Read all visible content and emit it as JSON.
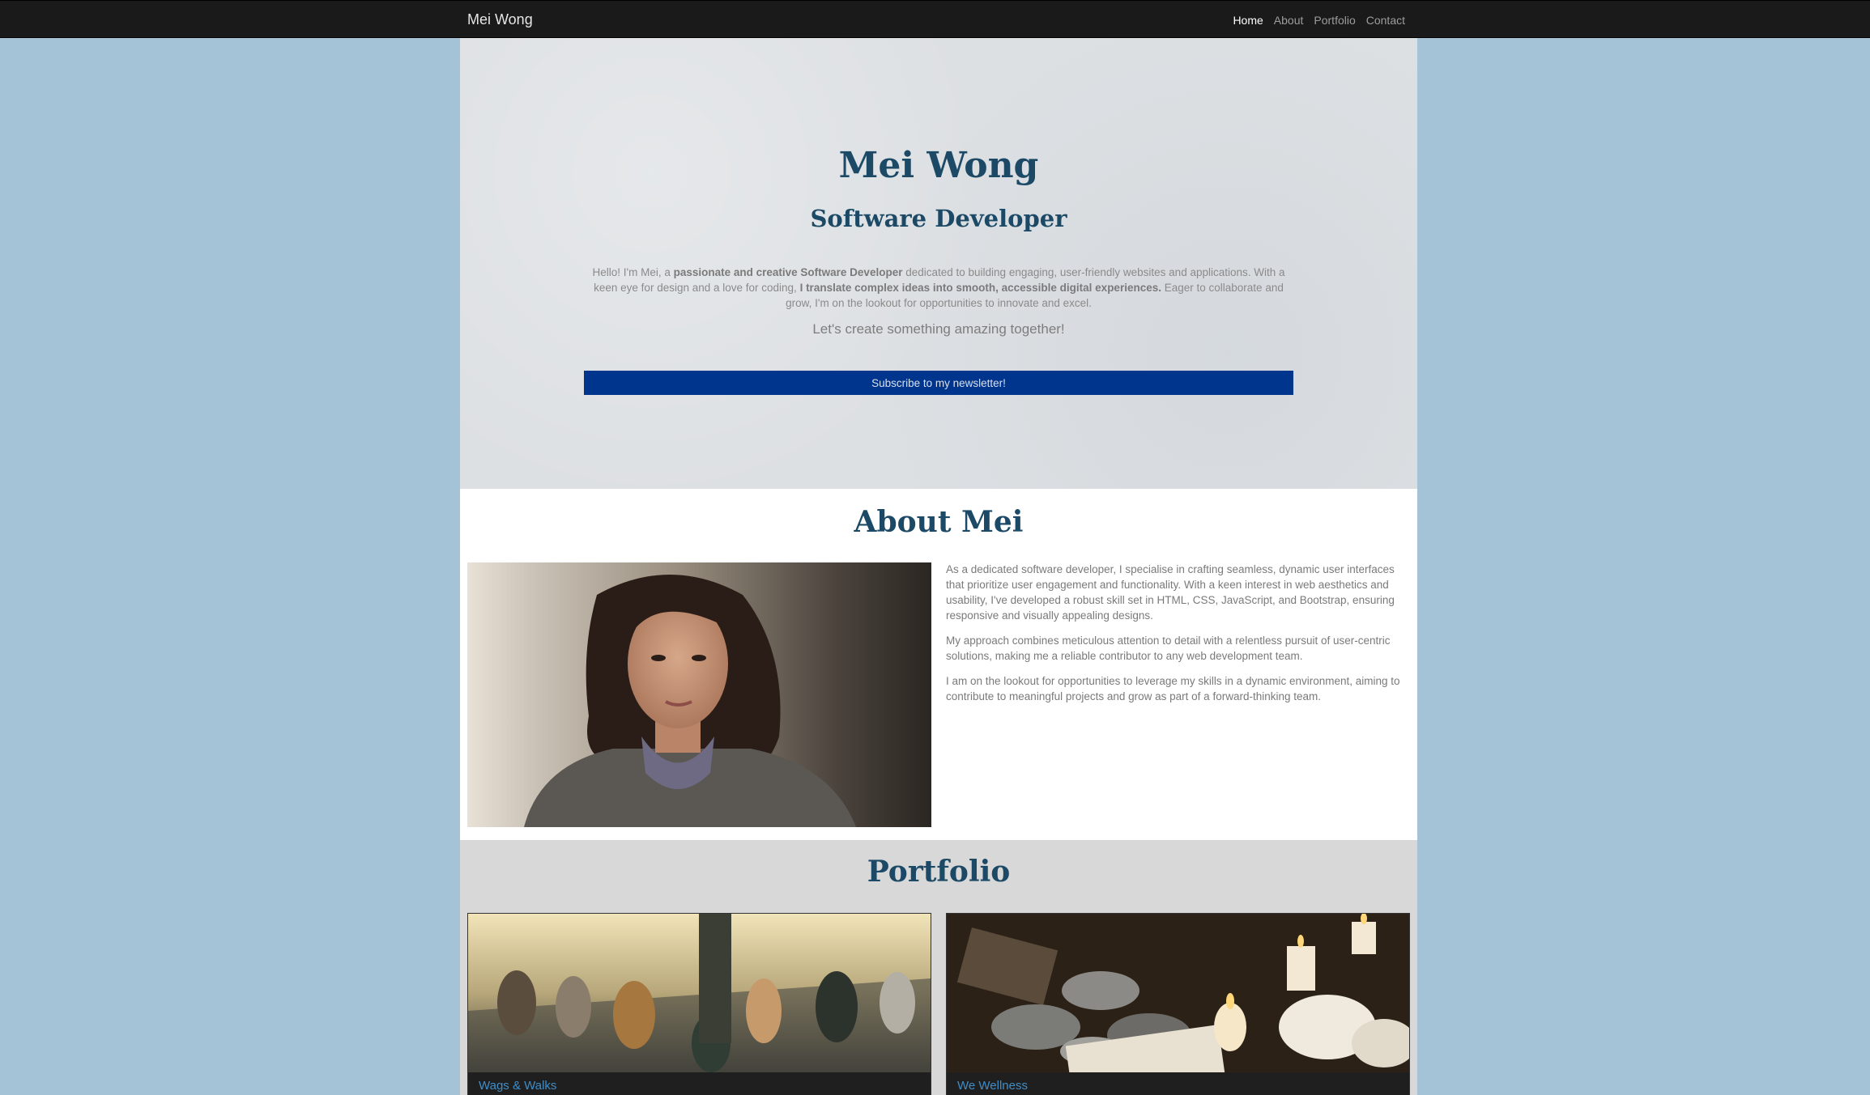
{
  "nav": {
    "brand": "Mei Wong",
    "links": [
      {
        "label": "Home"
      },
      {
        "label": "About"
      },
      {
        "label": "Portfolio"
      },
      {
        "label": "Contact"
      }
    ]
  },
  "hero": {
    "title": "Mei Wong",
    "subtitle": "Software Developer",
    "intro": {
      "p1": "Hello! I'm Mei, a ",
      "b1": "passionate and creative Software Developer",
      "p2": " dedicated to building engaging, user-friendly websites and applications. With a keen eye for design and a love for coding, ",
      "b2": "I translate complex ideas into smooth, accessible digital experiences.",
      "p3": " Eager to collaborate and grow, I'm on the lookout for opportunities to innovate and excel."
    },
    "cta_text": "Let's create something amazing together!",
    "subscribe_label": "Subscribe to my newsletter!"
  },
  "about": {
    "title": "About Mei",
    "paragraphs": [
      "As a dedicated software developer, I specialise in crafting seamless, dynamic user interfaces that prioritize user engagement and functionality. With a keen interest in web aesthetics and usability, I've developed a robust skill set in HTML, CSS, JavaScript, and Bootstrap, ensuring responsive and visually appealing designs.",
      "My approach combines meticulous attention to detail with a relentless pursuit of user-centric solutions, making me a reliable contributor to any web development team.",
      "I am on the lookout for opportunities to leverage my skills in a dynamic environment, aiming to contribute to meaningful projects and grow as part of a forward-thinking team."
    ]
  },
  "portfolio": {
    "title": "Portfolio",
    "items": [
      {
        "title": "Wags & Walks"
      },
      {
        "title": "We Wellness"
      }
    ]
  },
  "colors": {
    "page_bg": "#a5c3d6",
    "navbar_bg": "#1a1a1a",
    "heading": "#1c4a66",
    "button": "#00358e",
    "link": "#3f8ec9"
  }
}
